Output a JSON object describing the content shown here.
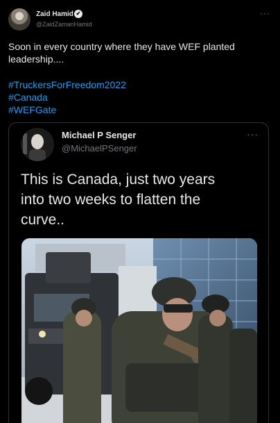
{
  "tweet": {
    "author_name": "Zaid Hamid",
    "verified_mark": "✔",
    "author_handle": "@ZaidZamanHamid",
    "more_label": "···",
    "text_lines": [
      "Soon in every country where they have WEF planted",
      "leadership...."
    ],
    "hashtags": [
      "#TruckersForFreedom2022",
      "#Canada",
      "#WEFGate"
    ]
  },
  "quoted": {
    "author_name": "Michael P Senger",
    "author_handle": "@MichaelPSenger",
    "more_label": "···",
    "text_lines": [
      "This is Canada, just two years",
      "into two weeks to flatten the",
      "curve.."
    ],
    "media_alt": "armed-police-and-armored-vehicle-photo"
  },
  "colors": {
    "background": "#000000",
    "text": "#e7e9ea",
    "muted": "#71767b",
    "link": "#1d9bf0",
    "border": "#2f3336"
  }
}
